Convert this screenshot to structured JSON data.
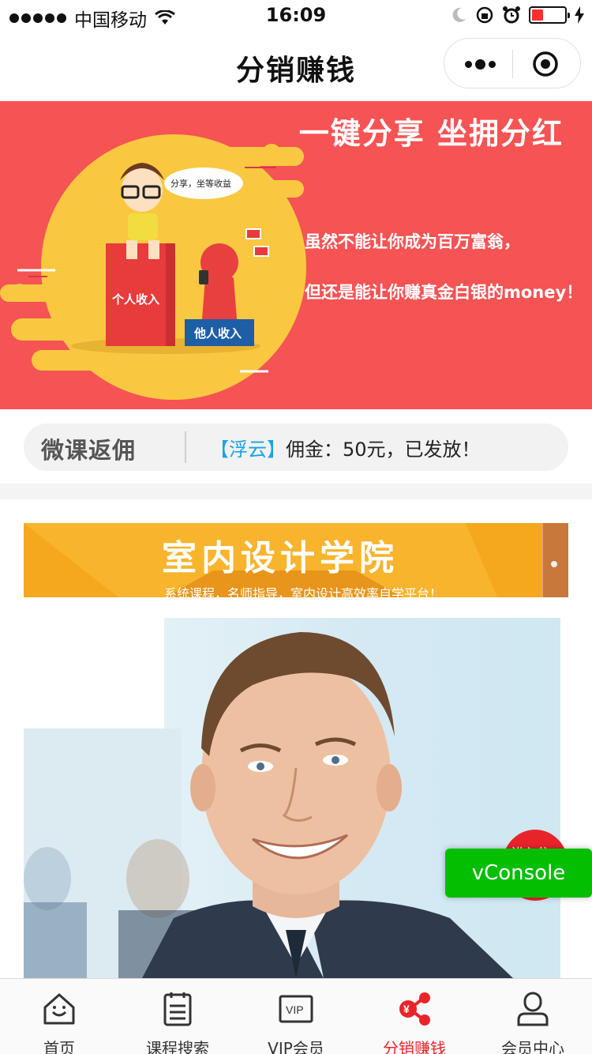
{
  "status_bar": {
    "carrier": "中国移动",
    "time": "16:09",
    "battery_level": 0.35
  },
  "nav": {
    "title": "分销赚钱",
    "more_icon": "more-icon",
    "close_icon": "target-icon"
  },
  "banner": {
    "headline": "一键分享 坐拥分红",
    "line1": "虽然不能让你成为百万富翁，",
    "line2": "但还是能让你赚真金白银的money！",
    "bubble": "分享，坐等收益",
    "box_personal": "个人收入",
    "box_others": "他人收入",
    "colors": {
      "background": "#f55354",
      "accent": "#f9c840"
    }
  },
  "notice": {
    "logo": "微课返佣",
    "name": "【浮云】",
    "message": "佣金：50元，已发放！"
  },
  "course": {
    "title": "室内设计学院",
    "subtitle": "系统课程，名师指导，室内设计高效率自学平台！"
  },
  "floating": {
    "red_button_text": "进入分",
    "vconsole": "vConsole"
  },
  "tabbar": {
    "tabs": [
      {
        "label": "首页",
        "icon": "home-icon",
        "active": false
      },
      {
        "label": "课程搜索",
        "icon": "clipboard-icon",
        "active": false
      },
      {
        "label": "VIP会员",
        "icon": "vip-icon",
        "active": false
      },
      {
        "label": "分销赚钱",
        "icon": "share-money-icon",
        "active": true
      },
      {
        "label": "会员中心",
        "icon": "user-icon",
        "active": false
      }
    ],
    "active_color": "#e8242a"
  }
}
